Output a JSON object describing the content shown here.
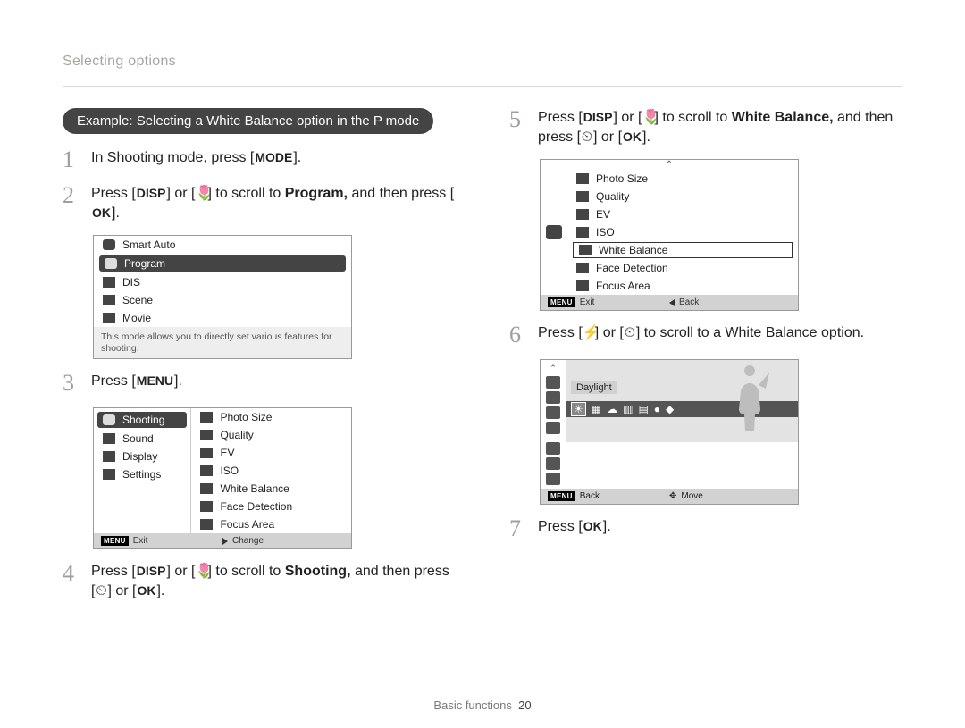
{
  "header": {
    "breadcrumb": "Selecting options"
  },
  "pill": "Example: Selecting a White Balance option in the P mode",
  "keys": {
    "mode": "MODE",
    "disp": "DISP",
    "ok": "OK",
    "menu": "MENU",
    "down_icon": "🌷",
    "timer_icon": "⏲",
    "flash_icon": "⚡"
  },
  "steps": {
    "s1": {
      "n": "1",
      "text_a": "In Shooting mode, press [",
      "text_b": "]."
    },
    "s2": {
      "n": "2",
      "a": "Press [",
      "b": "] or [",
      "c": "] to scroll to ",
      "target": "Program,",
      "d": " and then press [",
      "e": "]."
    },
    "s3": {
      "n": "3",
      "a": "Press [",
      "b": "]."
    },
    "s4": {
      "n": "4",
      "a": "Press [",
      "b": "] or [",
      "c": "] to scroll to ",
      "target": "Shooting,",
      "d": " and then press [",
      "e": "] or [",
      "f": "]."
    },
    "s5": {
      "n": "5",
      "a": "Press [",
      "b": "] or [",
      "c": "] to scroll to ",
      "target": "White Balance,",
      "d": " and then press [",
      "e": "] or [",
      "f": "]."
    },
    "s6": {
      "n": "6",
      "a": "Press [",
      "b": "] or [",
      "c": "] to scroll to a White Balance option."
    },
    "s7": {
      "n": "7",
      "a": "Press [",
      "b": "]."
    }
  },
  "lcd_modes": {
    "items": [
      "Smart Auto",
      "Program",
      "DIS",
      "Scene",
      "Movie"
    ],
    "selected_index": 1,
    "description": "This mode allows you to directly set various features for shooting."
  },
  "lcd_menu": {
    "left": [
      "Shooting",
      "Sound",
      "Display",
      "Settings"
    ],
    "left_selected": 0,
    "right": [
      "Photo Size",
      "Quality",
      "EV",
      "ISO",
      "White Balance",
      "Face Detection",
      "Focus Area"
    ],
    "foot_left_badge": "MENU",
    "foot_left": "Exit",
    "foot_right_glyph": "▶",
    "foot_right": "Change"
  },
  "lcd_submenu": {
    "items": [
      "Photo Size",
      "Quality",
      "EV",
      "ISO",
      "White Balance",
      "Face Detection",
      "Focus Area"
    ],
    "boxed_index": 4,
    "foot_left_badge": "MENU",
    "foot_left": "Exit",
    "foot_right_glyph": "◀",
    "foot_right": "Back"
  },
  "lcd_wb": {
    "label": "Daylight",
    "foot_left_badge": "MENU",
    "foot_left": "Back",
    "foot_right_glyph": "✥",
    "foot_right": "Move"
  },
  "footer": {
    "section": "Basic functions",
    "page": "20"
  }
}
